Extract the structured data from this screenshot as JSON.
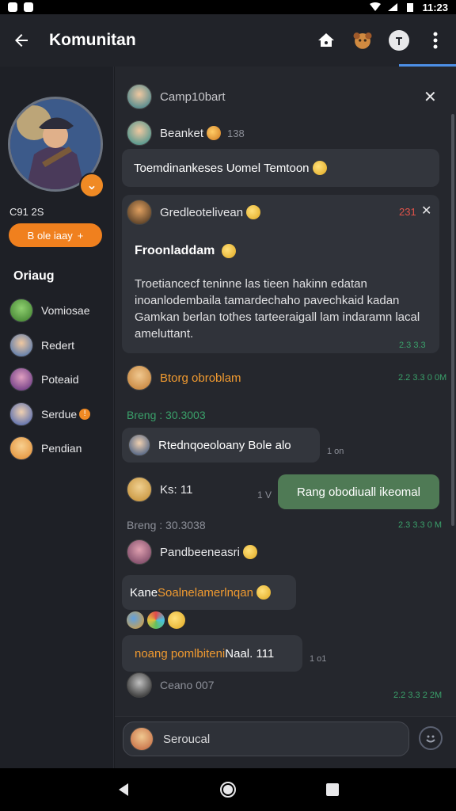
{
  "status_bar": {
    "time": "11:23"
  },
  "appbar": {
    "title": "Komunitan",
    "back_icon": "arrow-left-icon",
    "actions": [
      "home-icon",
      "avatar-icon",
      "info-icon",
      "more-vert-icon"
    ]
  },
  "sidebar": {
    "profile_name": "C91 2S",
    "follow_label": "B ole iaay",
    "follow_suffix": "+",
    "section_title": "Oriaug",
    "people": [
      {
        "name": "Vomiosae",
        "badge": ""
      },
      {
        "name": "Redert",
        "badge": ""
      },
      {
        "name": "Poteaid",
        "badge": ""
      },
      {
        "name": "Serdue",
        "badge": "!"
      },
      {
        "name": "Pendian",
        "badge": ""
      }
    ]
  },
  "chat": {
    "header_name": "Camp10bart",
    "m1": {
      "name": "Beanket",
      "count": "138",
      "text": "Toemdinankeses Uomel Temtoon"
    },
    "card": {
      "name": "Gredleotelivean",
      "count": "231",
      "heading": "Froonladdam",
      "body": "Troetiancecf teninne las tieen hakinn edatan inoanlodembaila tamardechaho pavechkaid kadan Gamkan berlan tothes tarteeraigall lam indaramn lacal ameluttant.",
      "time": "2.3 3.3"
    },
    "m2": {
      "name": "Btorg obroblam",
      "time": "2.2 3.3 0 0M"
    },
    "date1": "Breng : 30.3003",
    "m3": {
      "text": "Rtednqoeoloany Bole alo",
      "meta": "1 on"
    },
    "m4": {
      "name": "Ks: 11",
      "meta": "1 V"
    },
    "green_bubble": "Rang obodiuall ikeomal",
    "date2": "Breng : 30.3038",
    "time2": "2.3 3.3 0 M",
    "m5": {
      "name": "Pandbeeneasri"
    },
    "m6": {
      "prefix": "Kane ",
      "highlight": "Soalnelamerlnqan"
    },
    "m7": {
      "orange": "noang pomlbiteni",
      "rest": " Naal. 111",
      "meta": "1 o1"
    },
    "m8": {
      "name": "Ceano 007",
      "time": "2.2 3.3 2 2M"
    }
  },
  "composer": {
    "placeholder": "Seroucal"
  },
  "colors": {
    "accent": "#f0801e",
    "green": "#4f7a55",
    "link": "#4d8fe6"
  }
}
